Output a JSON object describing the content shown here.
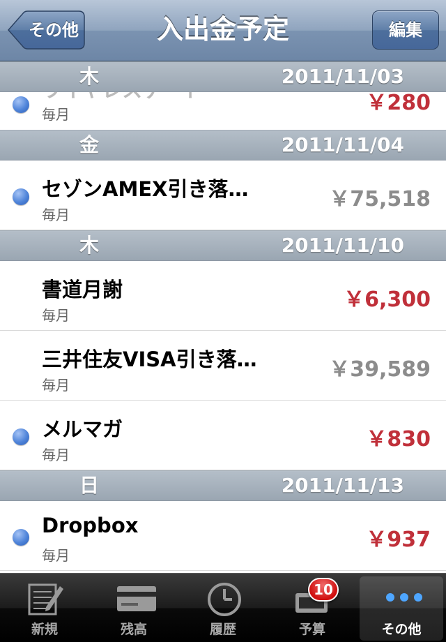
{
  "nav": {
    "title": "入出金予定",
    "back_label": "その他",
    "edit_label": "編集"
  },
  "sections": [
    {
      "day": "木",
      "date": "2011/11/03",
      "items": [
        {
          "name": "ワイヤレスゲート",
          "freq": "毎月",
          "amount": "￥280",
          "dot": true,
          "color": "red"
        }
      ]
    },
    {
      "day": "金",
      "date": "2011/11/04",
      "items": [
        {
          "name": "セゾンAMEX引き落…",
          "freq": "毎月",
          "amount": "￥75,518",
          "dot": true,
          "color": "gray"
        }
      ]
    },
    {
      "day": "木",
      "date": "2011/11/10",
      "items": [
        {
          "name": "書道月謝",
          "freq": "毎月",
          "amount": "￥6,300",
          "dot": false,
          "color": "red"
        },
        {
          "name": "三井住友VISA引き落…",
          "freq": "毎月",
          "amount": "￥39,589",
          "dot": false,
          "color": "gray"
        },
        {
          "name": "メルマガ",
          "freq": "毎月",
          "amount": "￥830",
          "dot": true,
          "color": "red"
        }
      ]
    },
    {
      "day": "日",
      "date": "2011/11/13",
      "items": [
        {
          "name": "Dropbox",
          "freq": "毎月",
          "amount": "￥937",
          "dot": true,
          "color": "red"
        }
      ]
    }
  ],
  "tabs": [
    {
      "label": "新規",
      "icon": "new-entry-icon"
    },
    {
      "label": "残高",
      "icon": "card-icon"
    },
    {
      "label": "履歴",
      "icon": "clock-icon"
    },
    {
      "label": "予算",
      "icon": "budget-icon",
      "badge": "10"
    },
    {
      "label": "その他",
      "icon": "more-icon",
      "active": true
    }
  ],
  "colors": {
    "amount_red": "#c0303a",
    "amount_gray": "#8c8c8c",
    "dot_blue": "#4f84d9",
    "badge_red": "#d00f0f"
  }
}
